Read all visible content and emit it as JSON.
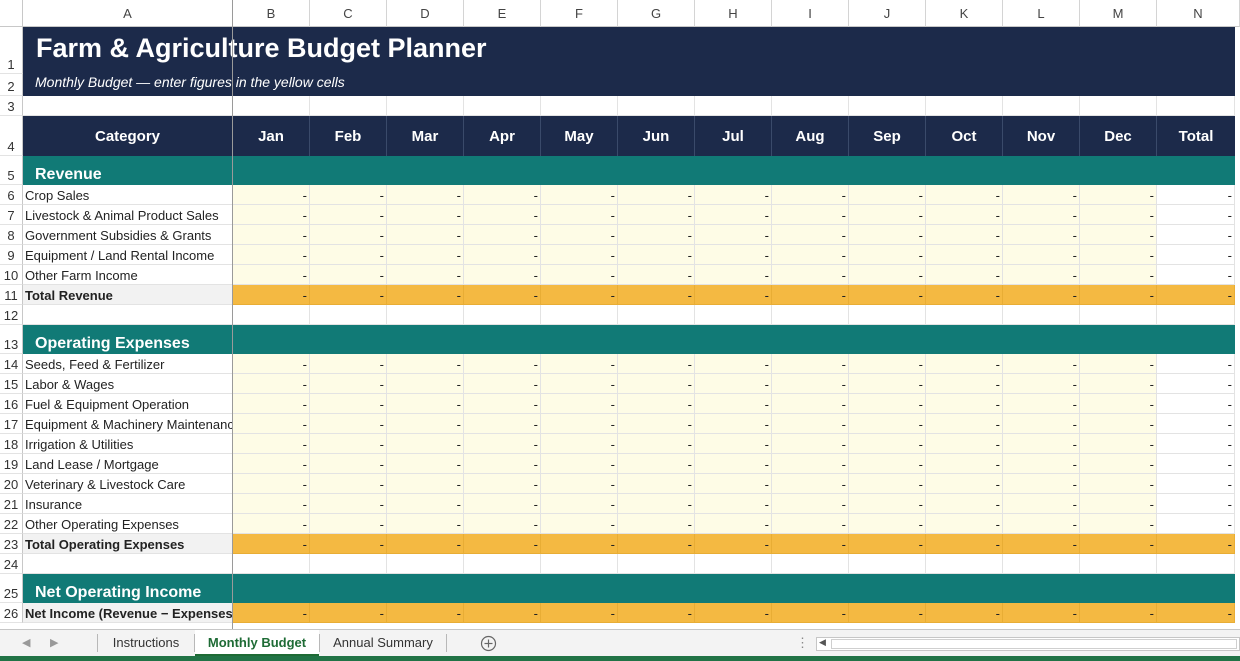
{
  "columns": [
    "A",
    "B",
    "C",
    "D",
    "E",
    "F",
    "G",
    "H",
    "I",
    "J",
    "K",
    "L",
    "M",
    "N"
  ],
  "title": "Farm & Agriculture Budget Planner",
  "subtitle": "Monthly Budget — enter figures in the yellow cells",
  "table_header": {
    "category": "Category",
    "months": [
      "Jan",
      "Feb",
      "Mar",
      "Apr",
      "May",
      "Jun",
      "Jul",
      "Aug",
      "Sep",
      "Oct",
      "Nov",
      "Dec"
    ],
    "total": "Total"
  },
  "empty_value": "-",
  "row_numbers": [
    "1",
    "2",
    "3",
    "4",
    "5",
    "6",
    "7",
    "8",
    "9",
    "10",
    "11",
    "12",
    "13",
    "14",
    "15",
    "16",
    "17",
    "18",
    "19",
    "20",
    "21",
    "22",
    "23",
    "24",
    "25",
    "26"
  ],
  "sections": {
    "revenue": {
      "title": "Revenue",
      "items": [
        "Crop Sales",
        "Livestock & Animal Product Sales",
        "Government Subsidies & Grants",
        "Equipment / Land Rental Income",
        "Other Farm Income"
      ],
      "total_label": "Total Revenue"
    },
    "expenses": {
      "title": "Operating Expenses",
      "items": [
        "Seeds, Feed & Fertilizer",
        "Labor & Wages",
        "Fuel & Equipment Operation",
        "Equipment & Machinery Maintenance",
        "Irrigation & Utilities",
        "Land Lease / Mortgage",
        "Veterinary & Livestock Care",
        "Insurance",
        "Other Operating Expenses"
      ],
      "total_label": "Total Operating Expenses"
    },
    "net": {
      "title": "Net Operating Income",
      "items": [],
      "total_label": "Net Income (Revenue − Expenses)"
    }
  },
  "sheet_tabs": [
    "Instructions",
    "Monthly Budget",
    "Annual Summary"
  ],
  "active_tab": "Monthly Budget",
  "colors": {
    "navy": "#1c2a4a",
    "teal": "#117a76",
    "input_yellow": "#fefce6",
    "total_gold": "#f4b942",
    "excel_green": "#217346"
  }
}
